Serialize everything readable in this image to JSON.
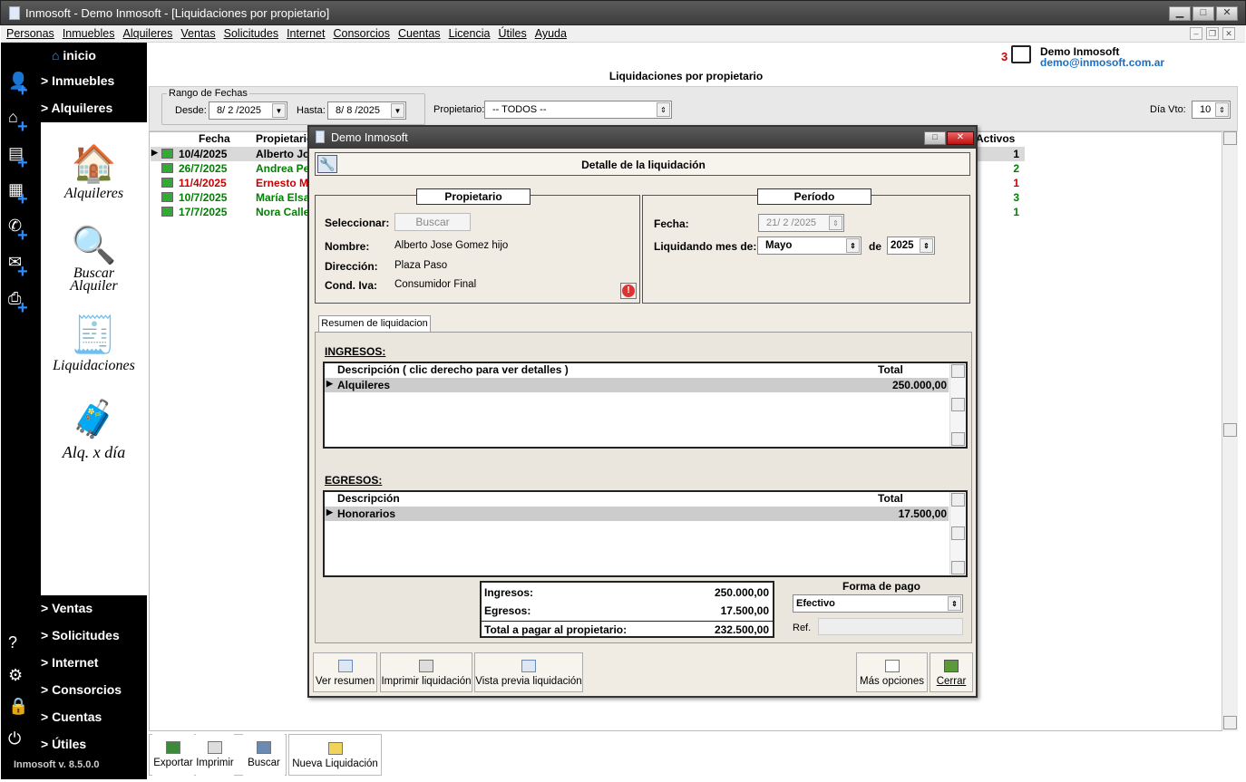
{
  "window": {
    "title": "Inmosoft - Demo Inmosoft - [Liquidaciones por propietario]"
  },
  "menu": [
    "Personas",
    "Inmuebles",
    "Alquileres",
    "Ventas",
    "Solicitudes",
    "Internet",
    "Consorcios",
    "Cuentas",
    "Licencia",
    "Útiles",
    "Ayuda"
  ],
  "nav": {
    "inicio": "inicio",
    "inmuebles": "> Inmuebles",
    "alquileres": "> Alquileres",
    "icons": {
      "alquileres": "Alquileres",
      "buscar1": "Buscar",
      "buscar2": "Alquiler",
      "liquidaciones": "Liquidaciones",
      "alq_dia": "Alq. x día"
    },
    "bottom": [
      "> Ventas",
      "> Solicitudes",
      "> Internet",
      "> Consorcios",
      "> Cuentas",
      "> Útiles"
    ],
    "version": "Inmosoft v. 8.5.0.0"
  },
  "header": {
    "count": "3",
    "user": "Demo Inmosoft",
    "email": "demo@inmosoft.com.ar",
    "page_title": "Liquidaciones por propietario"
  },
  "filters": {
    "range_label": "Rango de Fechas",
    "desde_label": "Desde:",
    "desde": "8/ 2 /2025",
    "hasta_label": "Hasta:",
    "hasta": "8/ 8 /2025",
    "propietario_label": "Propietario:",
    "propietario": "-- TODOS --",
    "dia_vto_label": "Día Vto:",
    "dia_vto": "10"
  },
  "grid": {
    "headers": {
      "fecha": "Fecha",
      "propietario": "Propietario",
      "activos": "Activos"
    },
    "rows": [
      {
        "fecha": "10/4/2025",
        "prop": "Alberto Jo",
        "activos": "1",
        "color": "#000000"
      },
      {
        "fecha": "26/7/2025",
        "prop": "Andrea Pe",
        "activos": "2",
        "color": "#008000"
      },
      {
        "fecha": "11/4/2025",
        "prop": "Ernesto M",
        "activos": "1",
        "color": "#cc0000"
      },
      {
        "fecha": "10/7/2025",
        "prop": "María Elsa",
        "activos": "3",
        "color": "#008000"
      },
      {
        "fecha": "17/7/2025",
        "prop": "Nora Calle",
        "activos": "1",
        "color": "#008000"
      }
    ]
  },
  "toolbar": {
    "exportar": "Exportar",
    "imprimir": "Imprimir",
    "buscar": "Buscar",
    "nueva": "Nueva Liquidación"
  },
  "dialog": {
    "title": "Demo Inmosoft",
    "header": "Detalle de la liquidación",
    "propietario": {
      "title": "Propietario",
      "seleccionar": "Seleccionar:",
      "buscar": "Buscar",
      "nombre_l": "Nombre:",
      "nombre": "Alberto Jose Gomez hijo",
      "direccion_l": "Dirección:",
      "direccion": "Plaza Paso",
      "iva_l": "Cond. Iva:",
      "iva": "Consumidor Final"
    },
    "periodo": {
      "title": "Período",
      "fecha_l": "Fecha:",
      "fecha": "21/ 2 /2025",
      "mes_l": "Liquidando mes de:",
      "mes": "Mayo",
      "de": "de",
      "anio": "2025"
    },
    "tab": "Resumen de liquidacion",
    "ingresos": {
      "title": "INGRESOS:",
      "col1": "Descripción ( clic derecho para ver detalles )",
      "col2": "Total",
      "row": "Alquileres",
      "total": "250.000,00"
    },
    "egresos": {
      "title": "EGRESOS:",
      "col1": "Descripción",
      "col2": "Total",
      "row": "Honorarios",
      "total": "17.500,00"
    },
    "totales": {
      "ing_l": "Ingresos:",
      "ing": "250.000,00",
      "egr_l": "Egresos:",
      "egr": "17.500,00",
      "tot_l": "Total a pagar al propietario:",
      "tot": "232.500,00"
    },
    "pago": {
      "label": "Forma de pago",
      "value": "Efectivo",
      "ref": "Ref."
    },
    "buttons": {
      "ver": "Ver resumen",
      "imprimir": "Imprimir liquidación",
      "vista": "Vista previa liquidación",
      "mas": "Más opciones",
      "cerrar": "Cerrar"
    }
  }
}
